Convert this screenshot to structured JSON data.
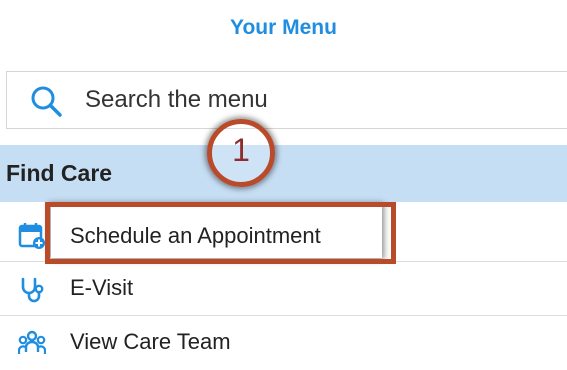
{
  "menu_title": "Your Menu",
  "search": {
    "placeholder": "Search the menu",
    "value": ""
  },
  "section": {
    "label": "Find Care"
  },
  "items": [
    {
      "label": "Schedule an Appointment",
      "icon": "calendar-icon"
    },
    {
      "label": "E-Visit",
      "icon": "stethoscope-icon"
    },
    {
      "label": "View Care Team",
      "icon": "care-team-icon"
    }
  ],
  "annotation": {
    "step_number": "1"
  },
  "colors": {
    "title": "#1f8ee0",
    "icon_blue": "#1f8ee0",
    "section_bg": "#c6def4",
    "annotation": "#b94a2a"
  }
}
